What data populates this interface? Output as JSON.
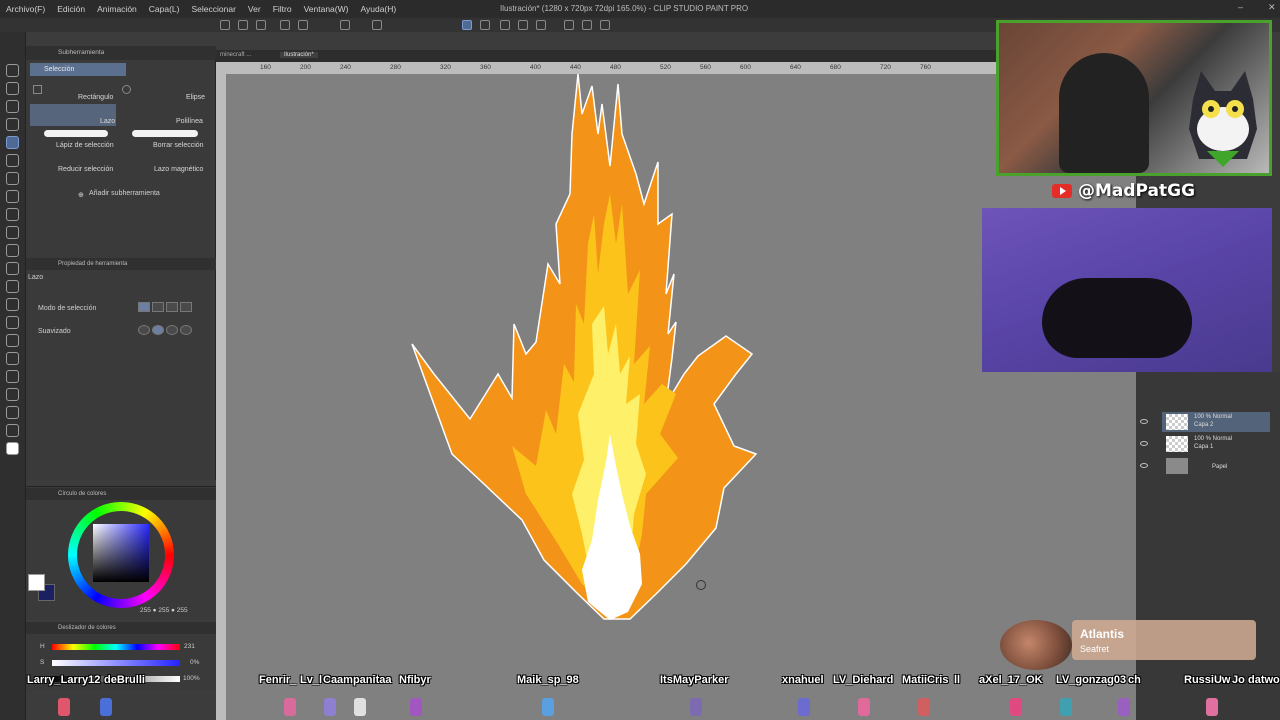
{
  "window": {
    "title": "Ilustración* (1280 x 720px 72dpi 165.0%) - CLIP STUDIO PAINT PRO"
  },
  "menu": [
    "Archivo(F)",
    "Edición",
    "Animación",
    "Capa(L)",
    "Seleccionar",
    "Ver",
    "Filtro",
    "Ventana(W)",
    "Ayuda(H)"
  ],
  "subtool": {
    "tab": "Subherramienta",
    "group": "Selección",
    "items": [
      "Rectángulo",
      "Elipse",
      "Lazo",
      "Polilínea",
      "Lápiz de selección",
      "Borrar selección",
      "Reducir selección",
      "Lazo magnético"
    ],
    "add_label": "Añadir subherramienta"
  },
  "tool_property": {
    "title": "Propiedad de herramienta",
    "tool_name": "Lazo",
    "mode_label": "Modo de selección",
    "smooth_label": "Suavizado"
  },
  "color": {
    "circle_title": "Círculo de colores",
    "fg": "#ffffff",
    "bg": "#1b2060",
    "rgb_readout": "255 ● 255 ● 255",
    "slider_title": "Deslizador de colores",
    "h_label": "H",
    "h_value": "231",
    "s_label": "S",
    "s_value": "0%",
    "v_value": "100%"
  },
  "document": {
    "tabs": [
      "minecraft ...",
      "Ilustración*"
    ],
    "ruler_ticks": [
      "160",
      "200",
      "240",
      "280",
      "320",
      "360",
      "400",
      "440",
      "480",
      "520",
      "560",
      "600",
      "640",
      "680",
      "720",
      "760"
    ]
  },
  "layers": {
    "blend": "Normal",
    "items": [
      {
        "opacity": "100 % Normal",
        "name": "Capa 2"
      },
      {
        "opacity": "100 % Normal",
        "name": "Capa 1"
      },
      {
        "opacity": "",
        "name": "Papel"
      }
    ]
  },
  "stream": {
    "handle": "@MadPatGG",
    "alert_name": "Atlantis",
    "alert_sub": "Seafret",
    "chat_names": [
      "Larry_Larry12",
      "deBrulli",
      "Fenrir_",
      "Lv_l",
      "Caampanitaa",
      "Nfibyr",
      "Maik_sp_98",
      "ItsMayParker",
      "xnahuel",
      "LV_Diehard",
      "MatiiCris",
      "ll",
      "aXel_17_OK",
      "LV_gonzag03",
      "ch",
      "RussiUw",
      "Jo",
      "datwo"
    ]
  }
}
